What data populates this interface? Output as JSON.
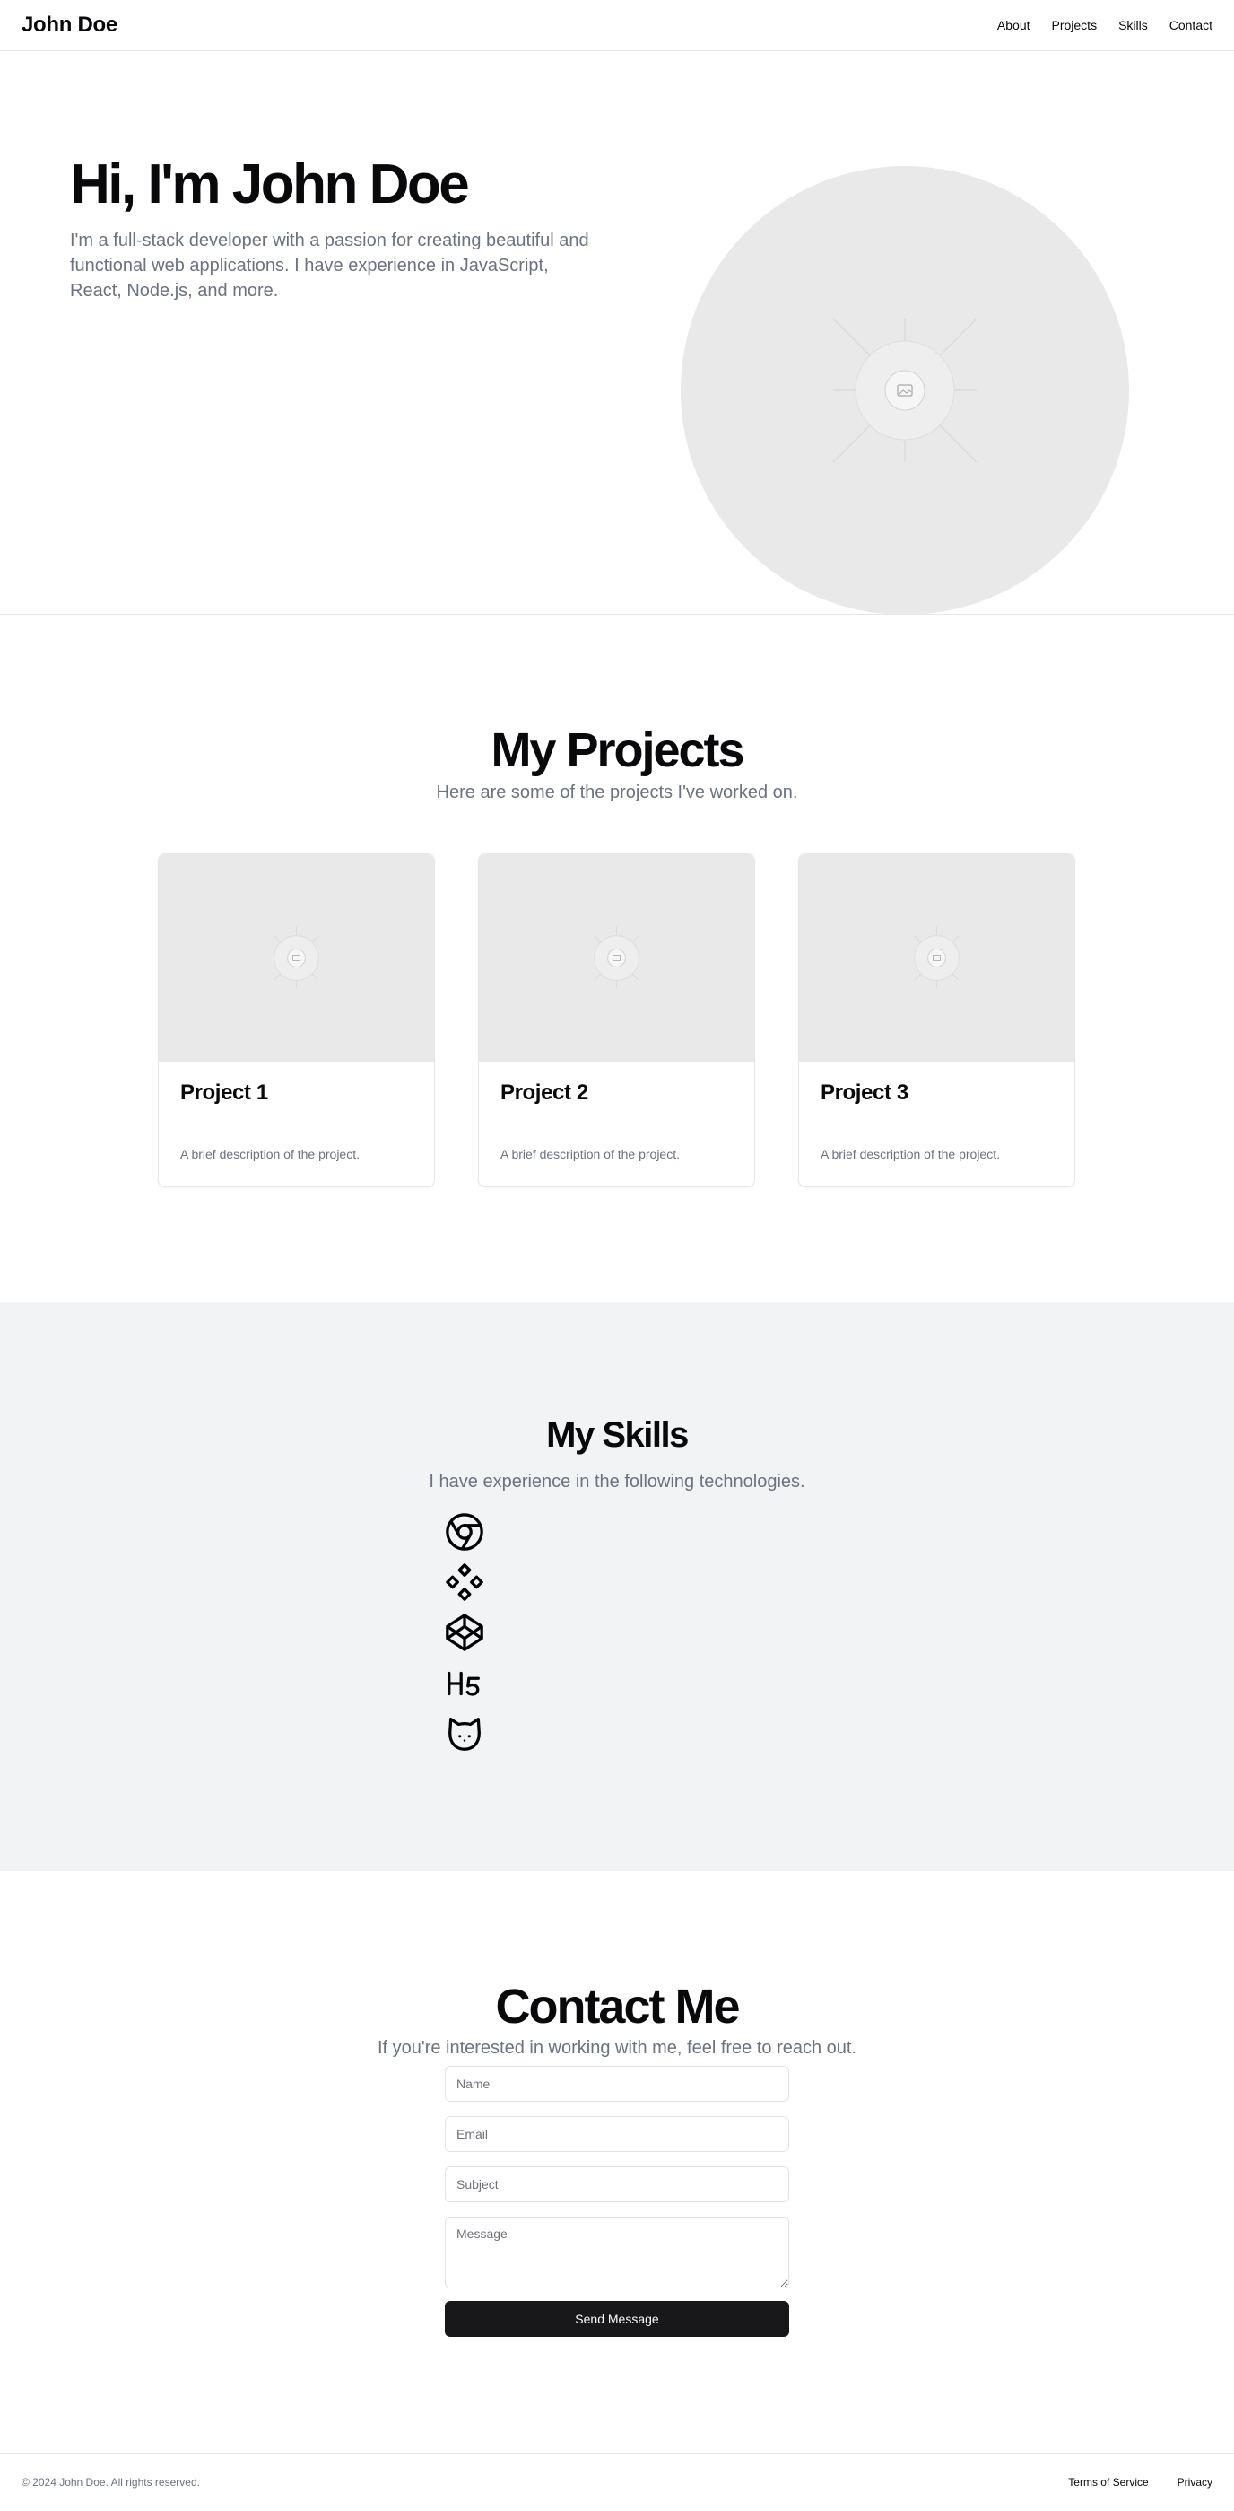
{
  "header": {
    "brand": "John Doe",
    "nav": [
      "About",
      "Projects",
      "Skills",
      "Contact"
    ]
  },
  "hero": {
    "title": "Hi, I'm John Doe",
    "subtitle": "I'm a full-stack developer with a passion for creating beautiful and functional web applications. I have experience in JavaScript, React, Node.js, and more.",
    "image_icon": "image-placeholder-icon"
  },
  "projects": {
    "title": "My Projects",
    "subtitle": "Here are some of the projects I've worked on.",
    "items": [
      {
        "title": "Project 1",
        "description": "A brief description of the project."
      },
      {
        "title": "Project 2",
        "description": "A brief description of the project."
      },
      {
        "title": "Project 3",
        "description": "A brief description of the project."
      }
    ]
  },
  "skills": {
    "title": "My Skills",
    "subtitle": "I have experience in the following technologies.",
    "icons": [
      "chrome-icon",
      "figma-diamonds-icon",
      "codepen-icon",
      "html5-icon",
      "github-cat-icon"
    ]
  },
  "contact": {
    "title": "Contact Me",
    "subtitle": "If you're interested in working with me, feel free to reach out.",
    "name_placeholder": "Name",
    "email_placeholder": "Email",
    "subject_placeholder": "Subject",
    "message_placeholder": "Message",
    "submit_label": "Send Message"
  },
  "footer": {
    "copyright": "© 2024 John Doe. All rights reserved.",
    "links": [
      "Terms of Service",
      "Privacy"
    ]
  },
  "colors": {
    "text": "#09090b",
    "muted": "#6b7280",
    "placeholder_bg": "#e9e9e9",
    "skills_bg": "#f2f3f5",
    "button_bg": "#18181b"
  }
}
